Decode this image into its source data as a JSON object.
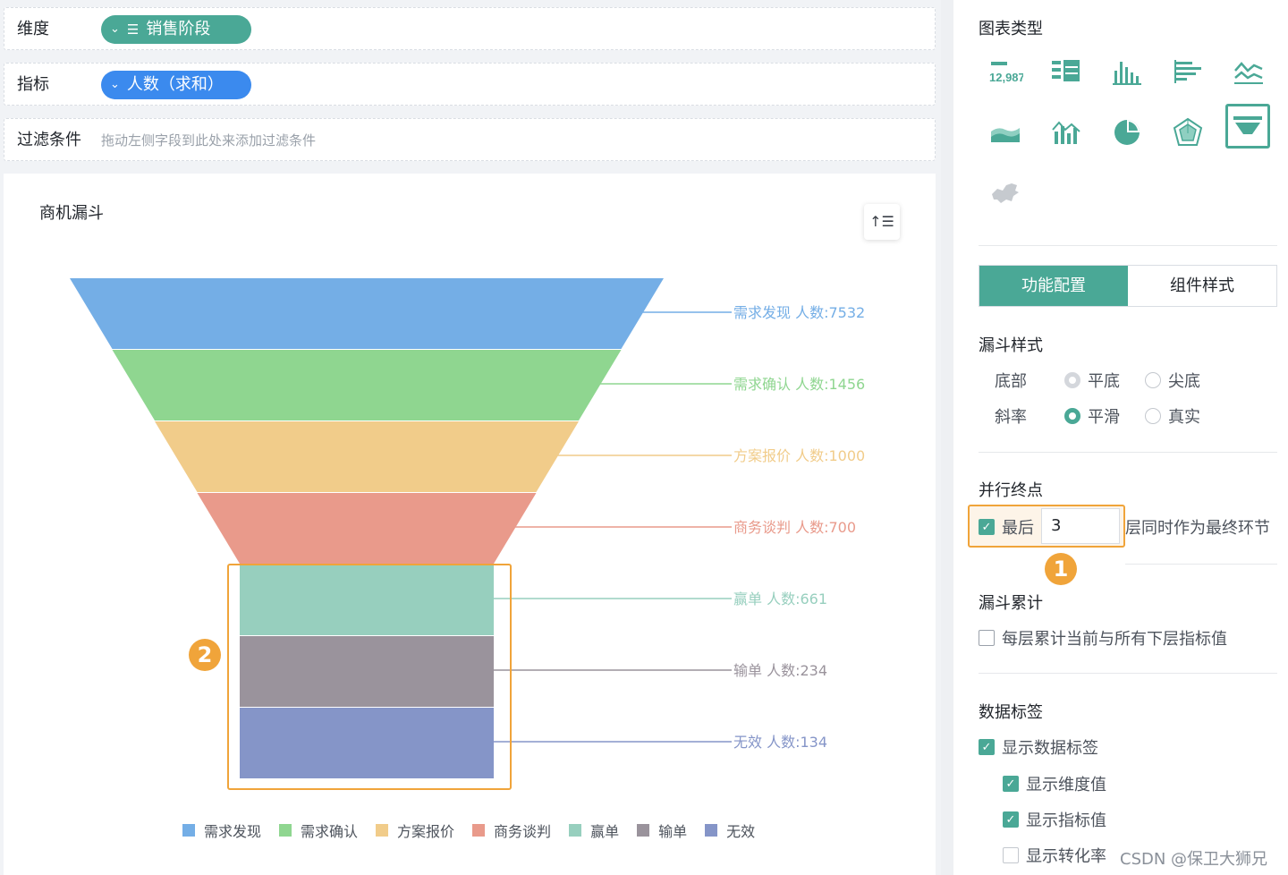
{
  "config_rows": {
    "dimension_label": "维度",
    "dimension_pill": "销售阶段",
    "metric_label": "指标",
    "metric_pill": "人数（求和）",
    "filter_label": "过滤条件",
    "filter_hint": "拖动左侧字段到此处来添加过滤条件"
  },
  "chart_card": {
    "title": "商机漏斗",
    "sort_icon": "sort-ascending-icon"
  },
  "chart_data": {
    "type": "funnel",
    "title": "商机漏斗",
    "categories": [
      "需求发现",
      "需求确认",
      "方案报价",
      "商务谈判",
      "赢单",
      "输单",
      "无效"
    ],
    "values": [
      7532,
      1456,
      1000,
      700,
      661,
      234,
      134
    ],
    "value_name": "人数",
    "labels": [
      "需求发现 人数:7532",
      "需求确认 人数:1456",
      "方案报价 人数:1000",
      "商务谈判 人数:700",
      "赢单 人数:661",
      "输单 人数:234",
      "无效 人数:134"
    ],
    "colors": [
      "#74aee6",
      "#8fd690",
      "#f1cc8a",
      "#e99a8b",
      "#97cfbe",
      "#9a939c",
      "#8595c8"
    ],
    "bottom_style": "平底",
    "parallel_last_layers": 3,
    "legend_position": "bottom-center"
  },
  "annotations": {
    "badge1": "1",
    "badge2": "2"
  },
  "right_panel": {
    "chart_type_title": "图表类型",
    "chart_types": [
      {
        "icon": "kpi-number-icon",
        "text": "12,987"
      },
      {
        "icon": "table-icon"
      },
      {
        "icon": "column-chart-icon"
      },
      {
        "icon": "bar-chart-icon"
      },
      {
        "icon": "line-chart-icon"
      },
      {
        "icon": "area-chart-icon"
      },
      {
        "icon": "combo-chart-icon"
      },
      {
        "icon": "pie-chart-icon"
      },
      {
        "icon": "radar-chart-icon"
      },
      {
        "icon": "funnel-chart-icon",
        "selected": true
      },
      {
        "icon": "map-chart-icon"
      }
    ],
    "tabs": [
      "功能配置",
      "组件样式"
    ],
    "active_tab": "功能配置",
    "funnel_style_title": "漏斗样式",
    "bottom_label": "底部",
    "bottom_options": [
      "平底",
      "尖底"
    ],
    "bottom_selected": "平底",
    "slope_label": "斜率",
    "slope_options": [
      "平滑",
      "真实"
    ],
    "slope_selected": "平滑",
    "parallel_title": "并行终点",
    "parallel_checkbox_label": "最后",
    "parallel_value": "3",
    "parallel_suffix": "层同时作为最终环节",
    "cumulative_title": "漏斗累计",
    "cumulative_checkbox_label": "每层累计当前与所有下层指标值",
    "data_label_title": "数据标签",
    "show_data_label": "显示数据标签",
    "show_dimension": "显示维度值",
    "show_metric": "显示指标值",
    "show_conversion": "显示转化率",
    "accent_color": "#4aa896",
    "highlight_color": "#f0a43a"
  },
  "watermark": "CSDN @保卫大狮兄"
}
